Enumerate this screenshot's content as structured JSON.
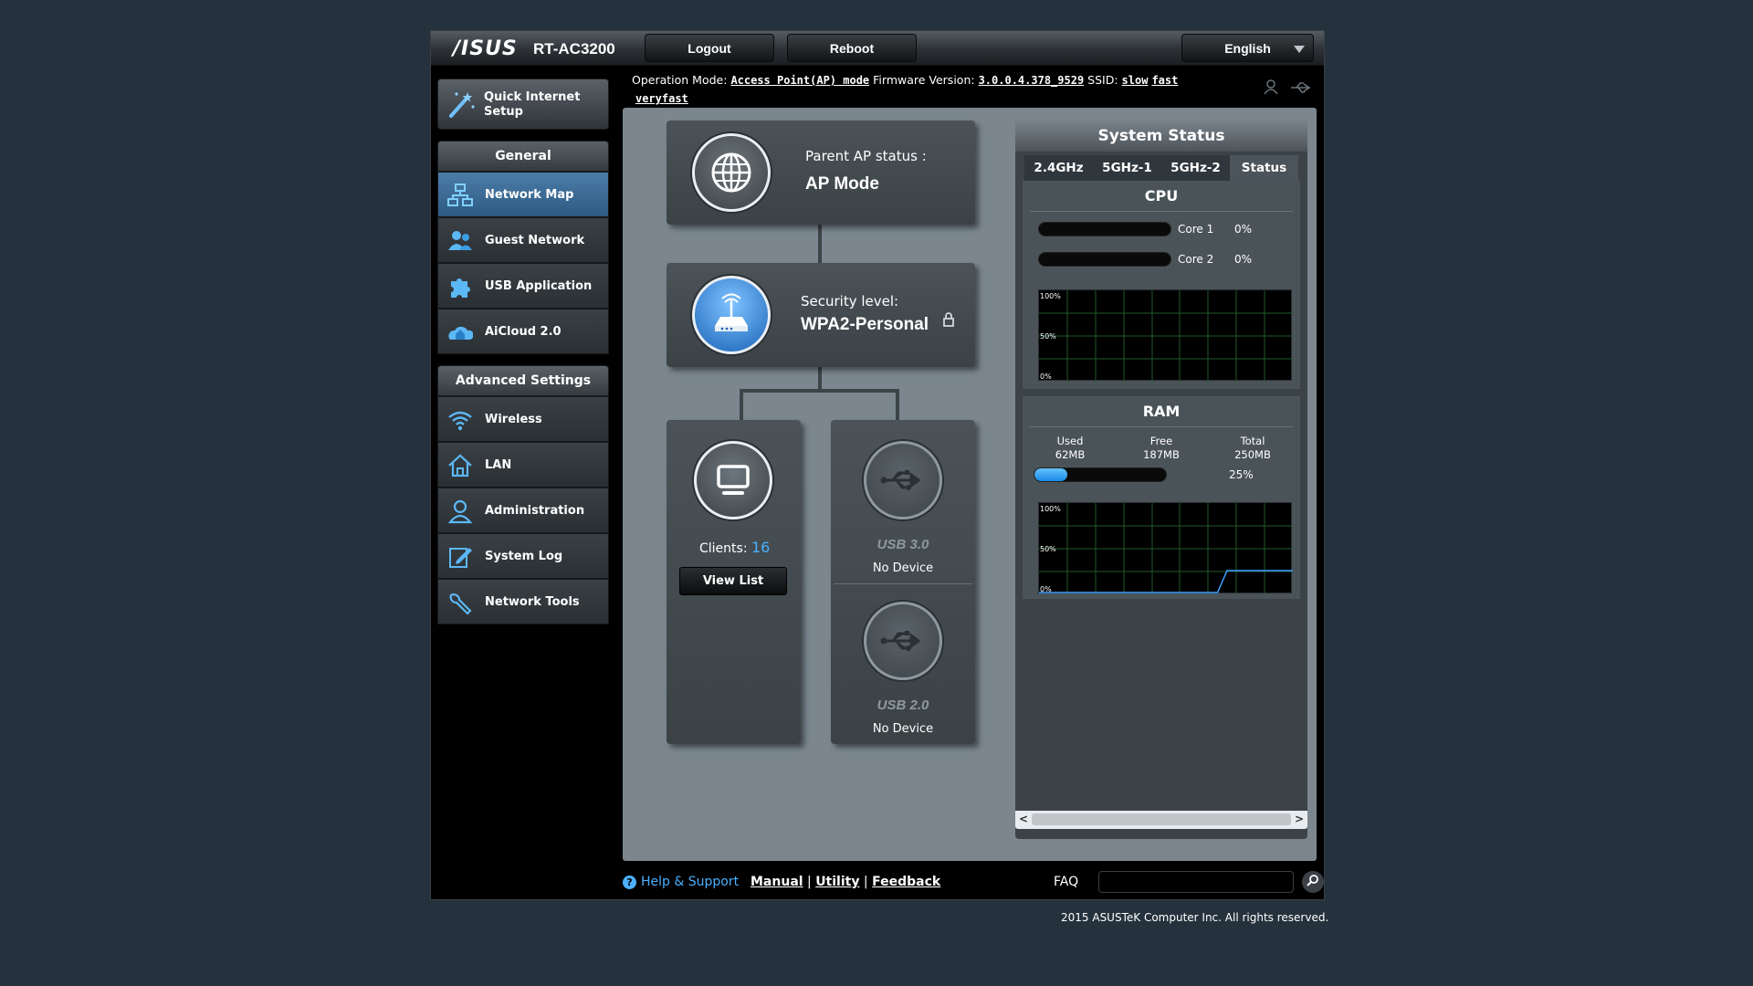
{
  "header": {
    "brand": "/ISUS",
    "model": "RT-AC3200",
    "logout_label": "Logout",
    "reboot_label": "Reboot",
    "language": "English"
  },
  "sidebar": {
    "quick_setup_label": "Quick Internet Setup",
    "general_title": "General",
    "general_items": [
      {
        "label": "Network Map",
        "active": true
      },
      {
        "label": "Guest Network"
      },
      {
        "label": "USB Application"
      },
      {
        "label": "AiCloud 2.0"
      }
    ],
    "advanced_title": "Advanced Settings",
    "advanced_items": [
      {
        "label": "Wireless"
      },
      {
        "label": "LAN"
      },
      {
        "label": "Administration"
      },
      {
        "label": "System Log"
      },
      {
        "label": "Network Tools"
      }
    ]
  },
  "status_line": {
    "op_mode_label": "Operation Mode:",
    "op_mode_value": "Access Point(AP) mode",
    "firmware_label": "Firmware Version:",
    "firmware_value": "3.0.0.4.378_9529",
    "ssid_label": "SSID:",
    "ssids": [
      "slow",
      "fast",
      "veryfast"
    ]
  },
  "network_map": {
    "parent_label": "Parent AP status :",
    "parent_value": "AP Mode",
    "security_label": "Security level:",
    "security_value": "WPA2-Personal",
    "clients_label": "Clients:",
    "clients_count": "16",
    "view_list_label": "View List",
    "usb3_label": "USB 3.0",
    "usb3_status": "No Device",
    "usb2_label": "USB 2.0",
    "usb2_status": "No Device"
  },
  "system_status": {
    "title": "System Status",
    "tabs": [
      "2.4GHz",
      "5GHz-1",
      "5GHz-2",
      "Status"
    ],
    "active_tab": 3,
    "cpu_title": "CPU",
    "cores": [
      {
        "name": "Core 1",
        "usage": "0%",
        "fraction": 0
      },
      {
        "name": "Core 2",
        "usage": "0%",
        "fraction": 0
      }
    ],
    "graph_labels": [
      "100%",
      "50%",
      "0%"
    ],
    "ram_title": "RAM",
    "ram_used_label": "Used",
    "ram_used": "62MB",
    "ram_free_label": "Free",
    "ram_free": "187MB",
    "ram_total_label": "Total",
    "ram_total": "250MB",
    "ram_percent": "25%",
    "ram_fraction": 0.25,
    "ram_history": [
      0,
      0,
      0,
      0,
      0,
      0,
      0,
      0,
      0,
      0,
      0,
      0,
      0,
      0,
      0,
      0,
      0,
      0,
      0,
      0,
      25,
      25,
      25,
      25,
      25,
      25,
      25,
      25
    ]
  },
  "footer": {
    "help_label": "Help & Support",
    "manual": "Manual",
    "utility": "Utility",
    "feedback": "Feedback",
    "faq_label": "FAQ",
    "copyright": "2015 ASUSTeK Computer Inc. All rights reserved."
  },
  "colors": {
    "accent": "#4ab0ff",
    "active_nav": "#3d6d98",
    "content_bg": "#7b868e"
  }
}
